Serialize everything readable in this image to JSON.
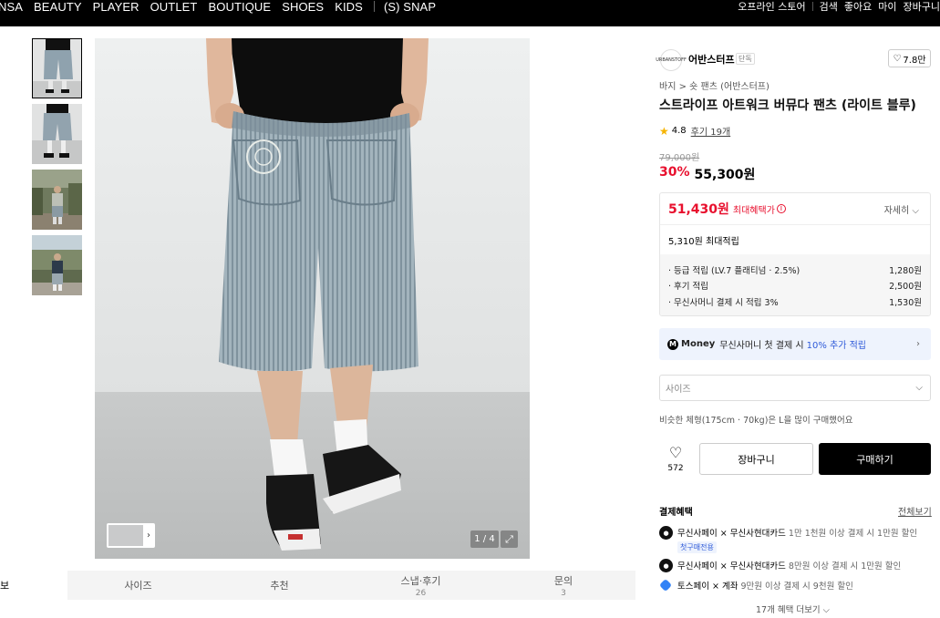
{
  "nav": {
    "left_items": [
      "NSA",
      "BEAUTY",
      "PLAYER",
      "OUTLET",
      "BOUTIQUE",
      "SHOES",
      "KIDS"
    ],
    "snap_label": "(S) SNAP",
    "right_items": [
      "오프라인 스토어",
      "검색",
      "좋아요",
      "마이",
      "장바구니"
    ]
  },
  "gallery": {
    "counter": "1 / 4",
    "thumbnail_count": 4
  },
  "tabs": [
    {
      "label": "보",
      "count": ""
    },
    {
      "label": "사이즈",
      "count": ""
    },
    {
      "label": "추천",
      "count": ""
    },
    {
      "label": "스냅·후기",
      "count": "26"
    },
    {
      "label": "문의",
      "count": "3"
    }
  ],
  "product": {
    "brand": "어반스터프",
    "brand_badge": "단독",
    "brand_logo_text": "URBANSTOFF",
    "likes": "7.8만",
    "breadcrumb": "바지 > 숏 팬츠 (어반스터프)",
    "title": "스트라이프 아트워크 버뮤다 팬츠 (라이트 블루)",
    "rating": "4.8",
    "review_label": "후기 19개",
    "original_price": "79,000원",
    "discount": "30%",
    "price": "55,300원"
  },
  "benefit": {
    "max_price": "51,430원",
    "max_label": "최대혜택가",
    "detail_label": "자세히",
    "points_total": "5,310원 최대적립",
    "rows": [
      {
        "label": "· 등급 적립 (LV.7 플래티넘 · 2.5%)",
        "value": "1,280원"
      },
      {
        "label": "· 후기 적립",
        "value": "2,500원"
      },
      {
        "label": "· 무신사머니 결제 시 적립 3%",
        "value": "1,530원"
      }
    ]
  },
  "money_bar": {
    "icon": "M",
    "label": "Money",
    "text": "무신사머니 첫 결제 시",
    "highlight": "10% 추가 적립"
  },
  "size_select": {
    "placeholder": "사이즈"
  },
  "similar_text": "비슷한 체형(175cm · 70kg)은 L을 많이 구매했어요",
  "actions": {
    "like_count": "572",
    "cart_label": "장바구니",
    "buy_label": "구매하기"
  },
  "payment": {
    "heading": "결제혜택",
    "all_label": "전체보기",
    "items": [
      {
        "title": "무신사페이 × 무신사현대카드",
        "desc": "1만 1천원 이상 결제 시 1만원 할인",
        "tag": "첫구매전용"
      },
      {
        "title": "무신사페이 × 무신사현대카드",
        "desc": "8만원 이상 결제 시 1만원 할인",
        "tag": ""
      },
      {
        "title": "토스페이 × 계좌",
        "desc": "9만원 이상 결제 시 9천원 할인",
        "tag": ""
      }
    ],
    "more_label": "17개 혜택 더보기"
  },
  "colors": {
    "accent_red": "#e8102e",
    "money_blue": "#2f5bd9",
    "money_bg": "#eef3fd",
    "star": "#f6b400"
  }
}
